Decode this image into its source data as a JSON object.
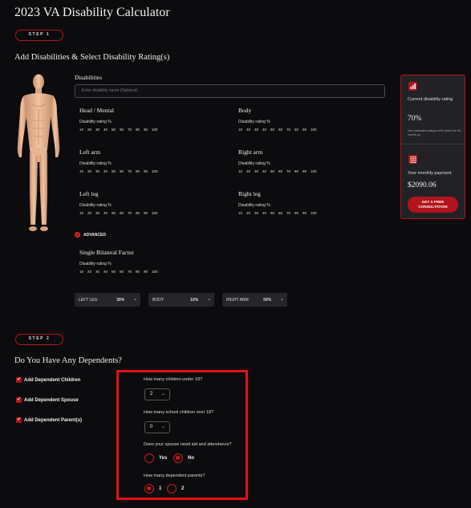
{
  "page": {
    "title": "2023 VA Disability Calculator"
  },
  "step1": {
    "pill": "STEP 1",
    "heading": "Add Disabilities & Select Disability Rating(s)",
    "disabilities_label": "Disabilities",
    "input_placeholder": "Enter disability name (Optional)",
    "rating_label": "Disability rating %",
    "ratings": [
      "10",
      "20",
      "30",
      "40",
      "50",
      "60",
      "70",
      "80",
      "90",
      "100"
    ],
    "groups": {
      "head": "Head / Mental",
      "body": "Body",
      "left_arm": "Left arm",
      "right_arm": "Right arm",
      "left_leg": "Left leg",
      "right_leg": "Right leg",
      "bilateral": "Single Bilateral Factor"
    },
    "advanced_label": "ADVANCED",
    "chips": [
      {
        "name": "LEFT LEG",
        "value": "30%"
      },
      {
        "name": "BODY",
        "value": "10%"
      },
      {
        "name": "RIGHT ARM",
        "value": "50%"
      }
    ],
    "chip_remove": "×"
  },
  "summary": {
    "current_label": "Current disability rating",
    "current_value": "70%",
    "current_note": "Your calculated rating is 69% which the VA rounds up.",
    "monthly_label": "Your monthly payment",
    "monthly_value": "$2090.06",
    "cta": "GET A FREE CONSULTATION",
    "accent": "#b1141c"
  },
  "step2": {
    "pill": "STEP 2",
    "heading": "Do You Have Any Dependents?",
    "checkboxes": [
      "Add Dependent Children",
      "Add Dependent Spouse",
      "Add Dependent Parent(s)"
    ],
    "q_children_under": "How many children under 18?",
    "children_under_value": "2",
    "q_school_children": "How many school children over 18?",
    "school_children_value": "0",
    "q_aid": "Does your spouse need aid and attendance?",
    "aid_yes": "Yes",
    "aid_no": "No",
    "q_parents": "How many dependent parents?",
    "parents_1": "1",
    "parents_2": "2"
  }
}
